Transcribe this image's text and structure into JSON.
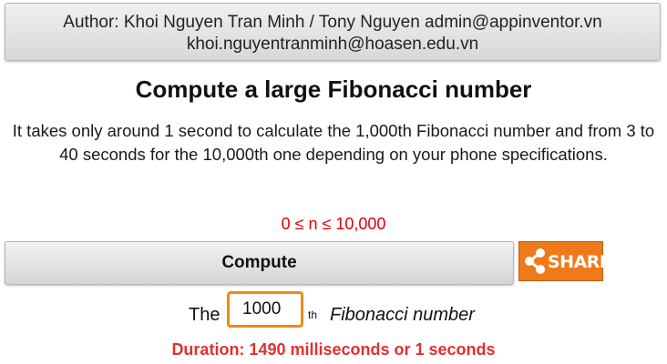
{
  "header": {
    "author_line1": "Author: Khoi Nguyen Tran Minh / Tony Nguyen admin@appinventor.vn",
    "author_line2": "khoi.nguyentranminh@hoasen.edu.vn"
  },
  "main": {
    "title": "Compute a large Fibonacci number",
    "description": "It takes only around 1 second to calculate the 1,000th Fibonacci number and from 3 to 40 seconds for the 10,000th one depending on your phone specifications.",
    "range_text": "0 ≤ n ≤ 10,000",
    "compute_label": "Compute",
    "share_label": "SHARE",
    "share_icon": "share-icon",
    "the_label": "The",
    "n_value": "1000",
    "th_label": "th",
    "fib_label": "Fibonacci number",
    "duration_text": "Duration: 1490 milliseconds or 1 seconds"
  },
  "colors": {
    "range": "#e00000",
    "duration": "#e03030",
    "share_bg": "#ef7a1a",
    "input_border": "#f08a10"
  }
}
